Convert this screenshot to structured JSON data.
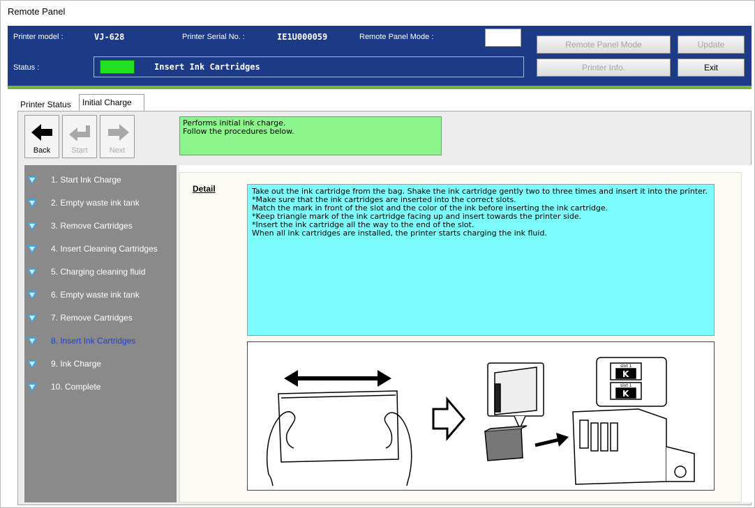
{
  "window": {
    "title": "Remote Panel"
  },
  "header": {
    "printer_model_label": "Printer model :",
    "printer_model_value": "VJ-628",
    "serial_label": "Printer Serial No. :",
    "serial_value": "IE1U000059",
    "remote_mode_label": "Remote Panel Mode :",
    "status_label": "Status :",
    "status_text": "Insert Ink Cartridges",
    "status_color": "#22e022",
    "buttons": {
      "remote_panel_mode": "Remote Panel Mode",
      "update": "Update",
      "printer_info": "Printer Info.",
      "exit": "Exit"
    }
  },
  "tabs": [
    {
      "label": "Printer Status"
    },
    {
      "label": "Initial Charge"
    }
  ],
  "toolbar": {
    "back": "Back",
    "start": "Start",
    "next": "Next"
  },
  "info": {
    "line1": "Performs initial ink charge.",
    "line2": "Follow the procedures below."
  },
  "steps": [
    {
      "label": "1. Start Ink Charge"
    },
    {
      "label": "2. Empty waste ink tank"
    },
    {
      "label": "3. Remove Cartridges"
    },
    {
      "label": "4. Insert Cleaning Cartridges"
    },
    {
      "label": "5. Charging cleaning fluid"
    },
    {
      "label": "6. Empty waste ink tank"
    },
    {
      "label": "7. Remove Cartridges"
    },
    {
      "label": "8. Insert Ink Cartridges"
    },
    {
      "label": "9. Ink Charge"
    },
    {
      "label": "10. Complete"
    }
  ],
  "active_step": 8,
  "detail": {
    "label": "Detail",
    "lines": [
      "Take out the ink cartridge from the bag. Shake the ink cartridge gently two to three times and insert it into the printer.",
      "*Make sure that the ink cartridges are inserted into the correct slots.",
      " Match the mark in front of the slot and the color of the ink before inserting the ink cartridge.",
      "*Keep triangle mark of the ink cartridge facing up and insert towards the printer side.",
      "*Insert the ink cartridge all the way to the end of the slot.",
      "When all ink cartridges are installed, the printer starts charging the ink fluid."
    ]
  },
  "illustration": {
    "slot_label_1": "slot 1",
    "slot_label_2": "slot 1",
    "ink_color_1": "K",
    "ink_color_2": "K"
  },
  "colors": {
    "header_bg": "#1d3a86",
    "accent_line": "#78b33c",
    "info_bg": "#8cf58c",
    "detail_bg": "#7cfcfc",
    "step_panel_bg": "#8a8a8a",
    "step_active": "#2340c8",
    "step_icon": "#3ea7ea"
  },
  "icons": {
    "back": "arrow-left-icon",
    "start": "return-arrow-icon",
    "next": "arrow-right-icon",
    "step": "triangle-down-icon"
  }
}
